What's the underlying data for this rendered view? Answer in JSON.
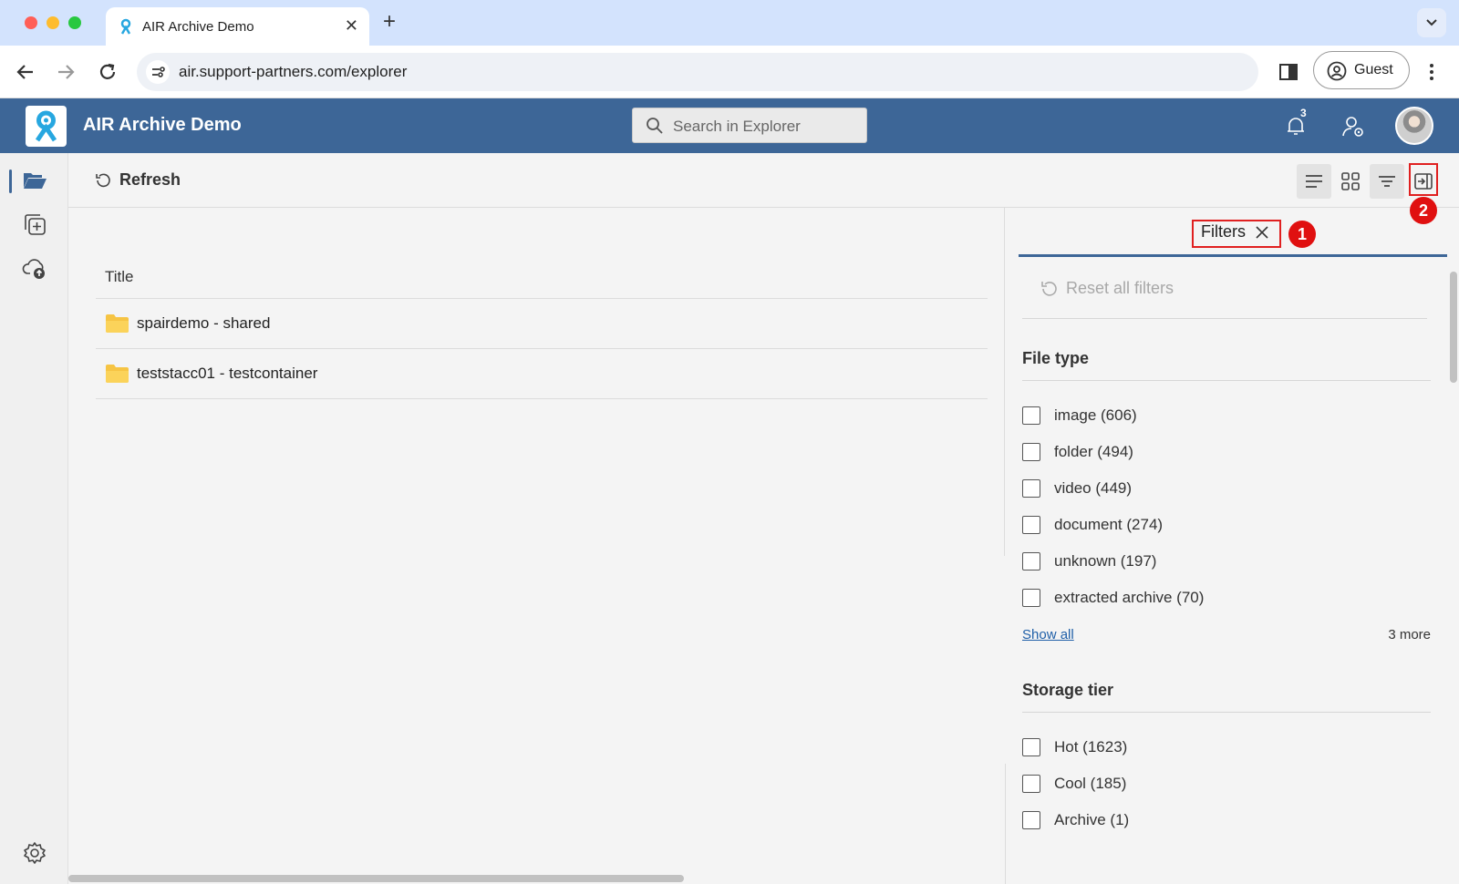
{
  "browser": {
    "tab_title": "AIR Archive Demo",
    "tab_close": "✕",
    "new_tab": "+",
    "url": "air.support-partners.com/explorer",
    "profile_label": "Guest"
  },
  "app": {
    "title": "AIR Archive Demo",
    "search_placeholder": "Search in Explorer",
    "notifications_count": "3"
  },
  "commands": {
    "refresh_label": "Refresh"
  },
  "list": {
    "column_title": "Title",
    "rows": [
      {
        "name": "spairdemo - shared",
        "icon": "folder-icon"
      },
      {
        "name": "teststacc01 - testcontainer",
        "icon": "folder-icon"
      }
    ]
  },
  "filters": {
    "tab_label": "Filters",
    "reset_label": "Reset all filters",
    "file_type": {
      "title": "File type",
      "items": [
        "image (606)",
        "folder (494)",
        "video (449)",
        "document (274)",
        "unknown (197)",
        "extracted archive (70)"
      ],
      "show_all": "Show all",
      "more": "3 more"
    },
    "storage_tier": {
      "title": "Storage tier",
      "items": [
        "Hot (1623)",
        "Cool (185)",
        "Archive (1)"
      ]
    }
  },
  "annotations": [
    "1",
    "2"
  ],
  "colors": {
    "appbar": "#3d6697",
    "tabbar": "#d3e3fd",
    "annotation_red": "#e02020",
    "folder_yellow": "#f6c443",
    "link_blue": "#1f5fa8"
  }
}
